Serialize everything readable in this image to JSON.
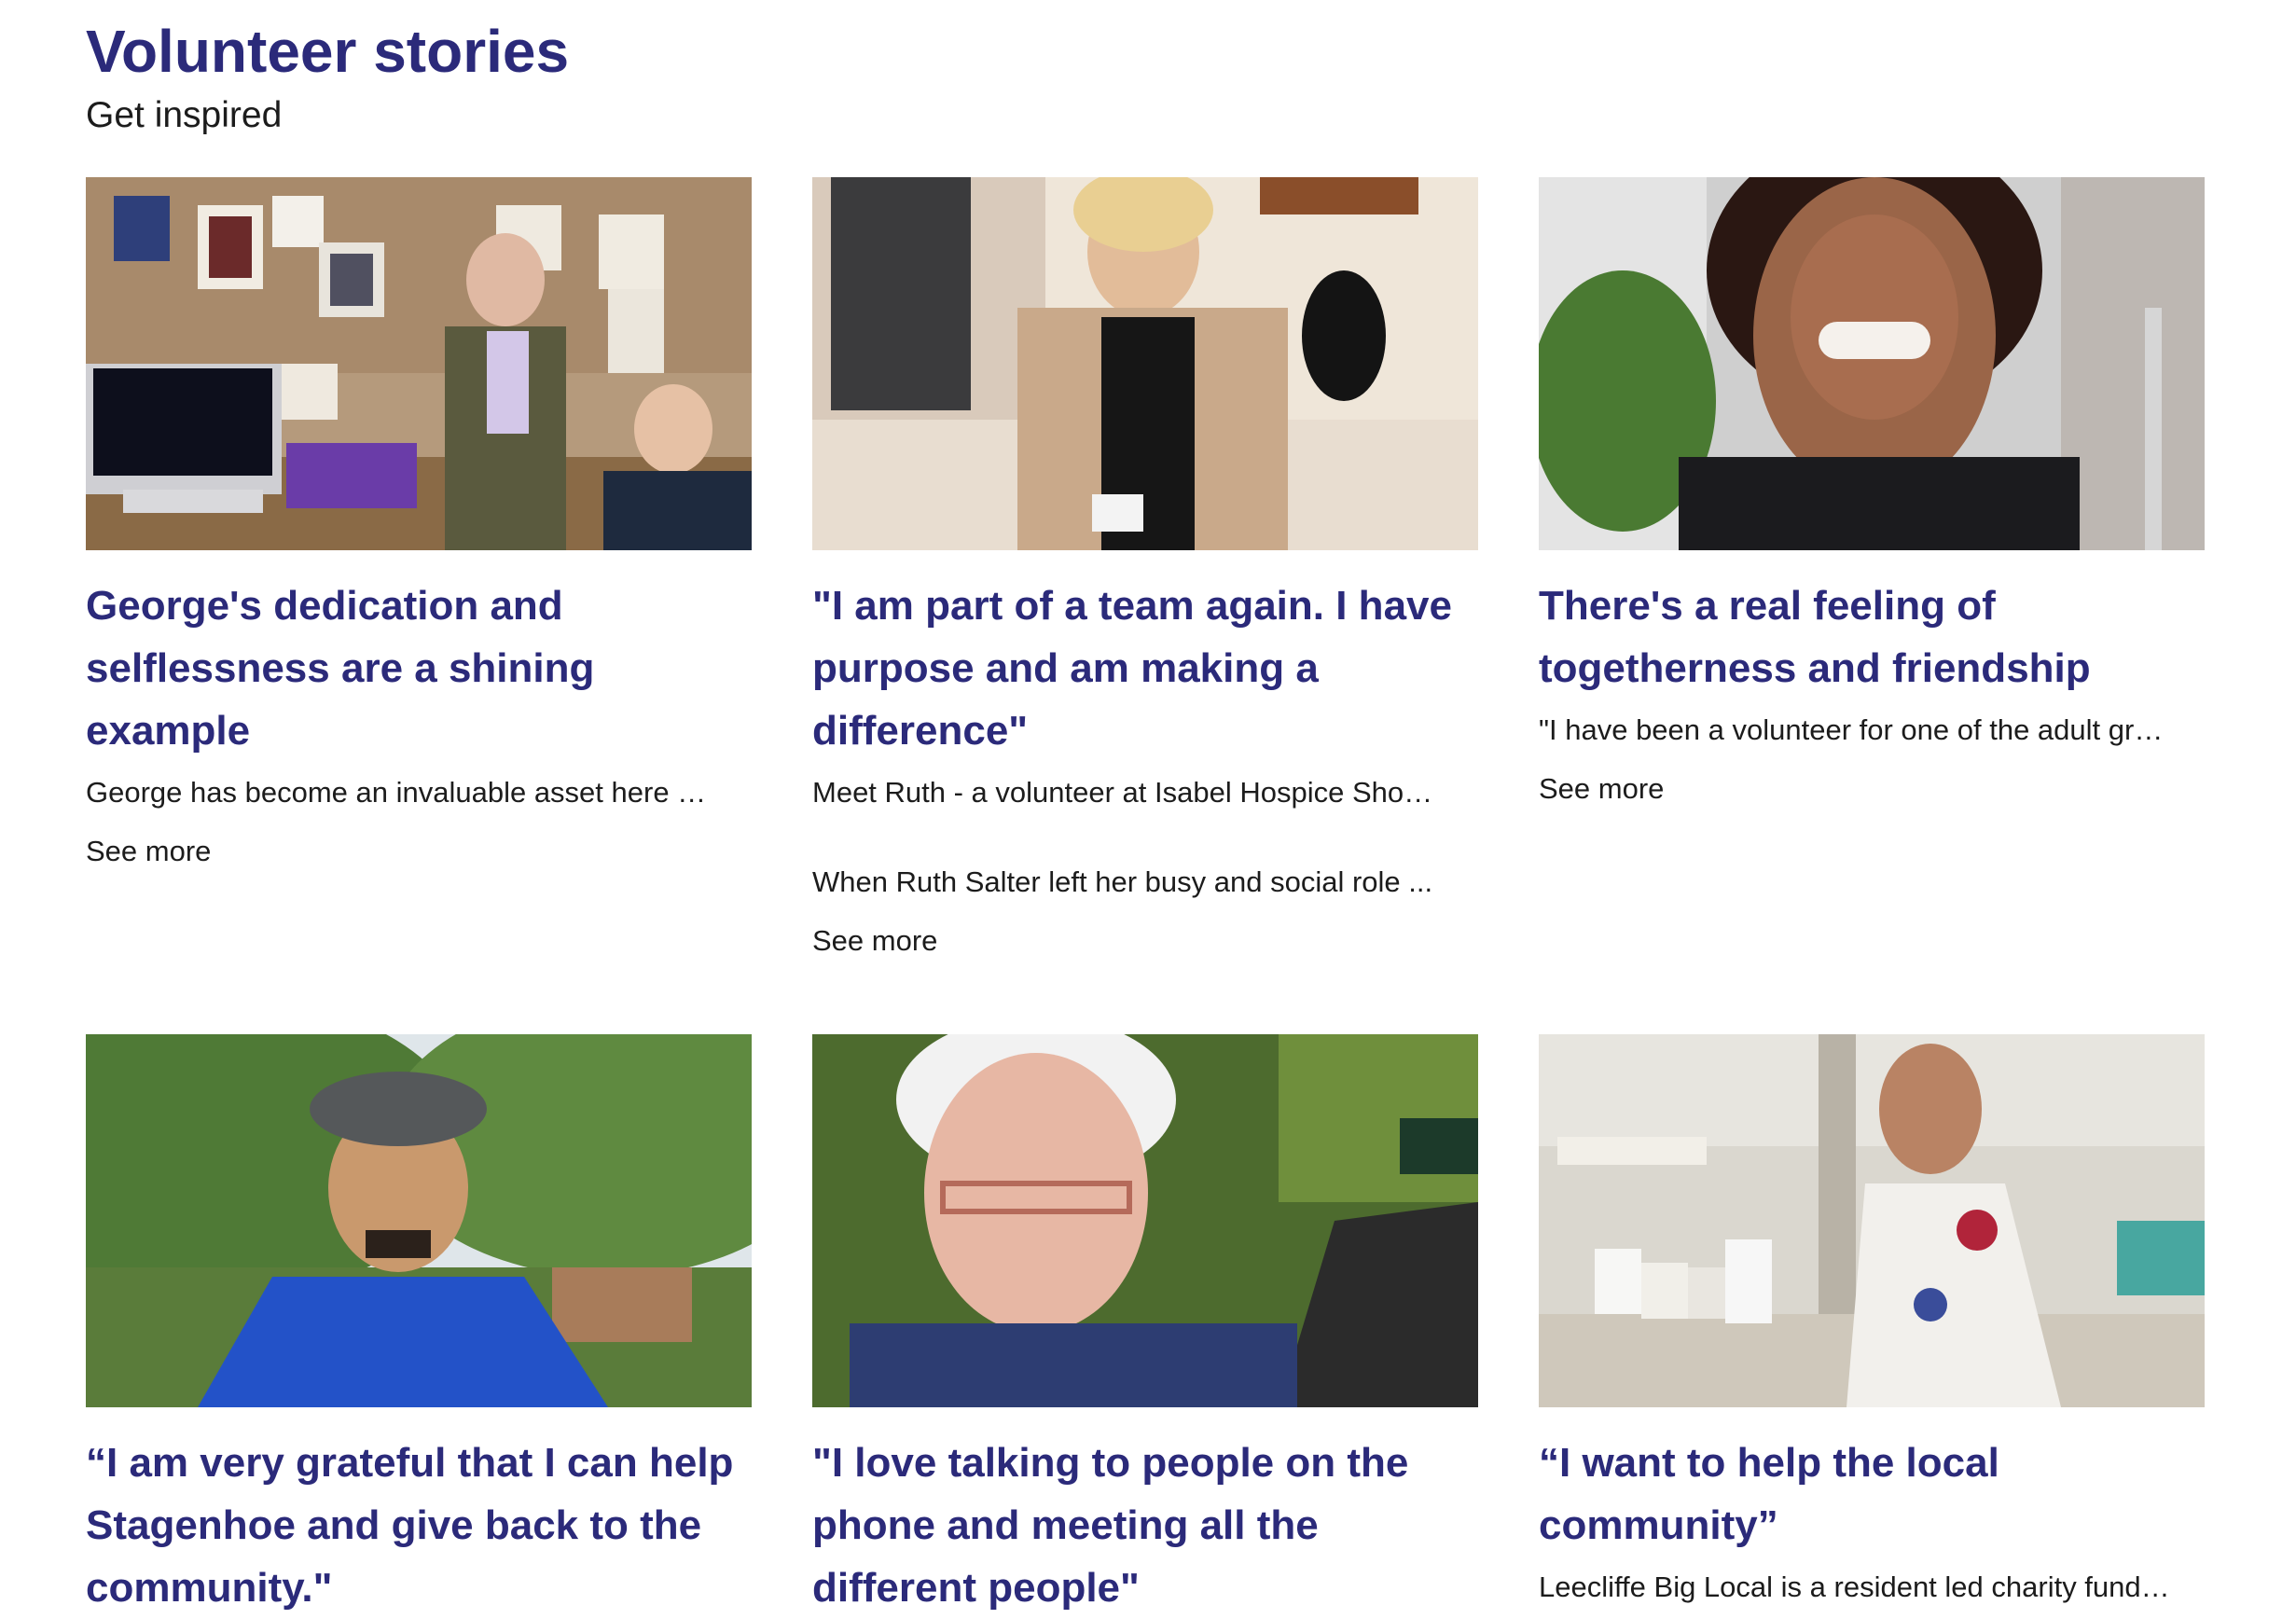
{
  "section": {
    "title": "Volunteer stories",
    "subtitle": "Get inspired"
  },
  "cards": [
    {
      "title": "George's dedication and selflessness are a shining example",
      "excerpt": "George has become an invaluable asset here …",
      "see_more": "See more"
    },
    {
      "title": "\"I am part of a team again. I have purpose and am making a difference\"",
      "excerpt": "Meet Ruth - a volunteer at Isabel Hospice Sho…",
      "excerpt2": "When Ruth Salter left her busy and social role ...",
      "see_more": "See more"
    },
    {
      "title": "There's a real feeling of togetherness and friendship",
      "excerpt": "\"I have been a volunteer for one of the adult gr…",
      "see_more": "See more"
    },
    {
      "title": "“I am very grateful that I can help Stagenhoe and give back to the community.\"",
      "excerpt": "",
      "see_more": ""
    },
    {
      "title": "\"I love talking to people on the phone and meeting all the different people\"",
      "excerpt": "",
      "see_more": ""
    },
    {
      "title": "“I want to help the local community”",
      "excerpt": "Leecliffe Big Local is a resident led charity fund…",
      "see_more": ""
    }
  ],
  "colors": {
    "heading": "#2b2a7a",
    "body_text": "#1c1c1c",
    "background": "#ffffff"
  }
}
